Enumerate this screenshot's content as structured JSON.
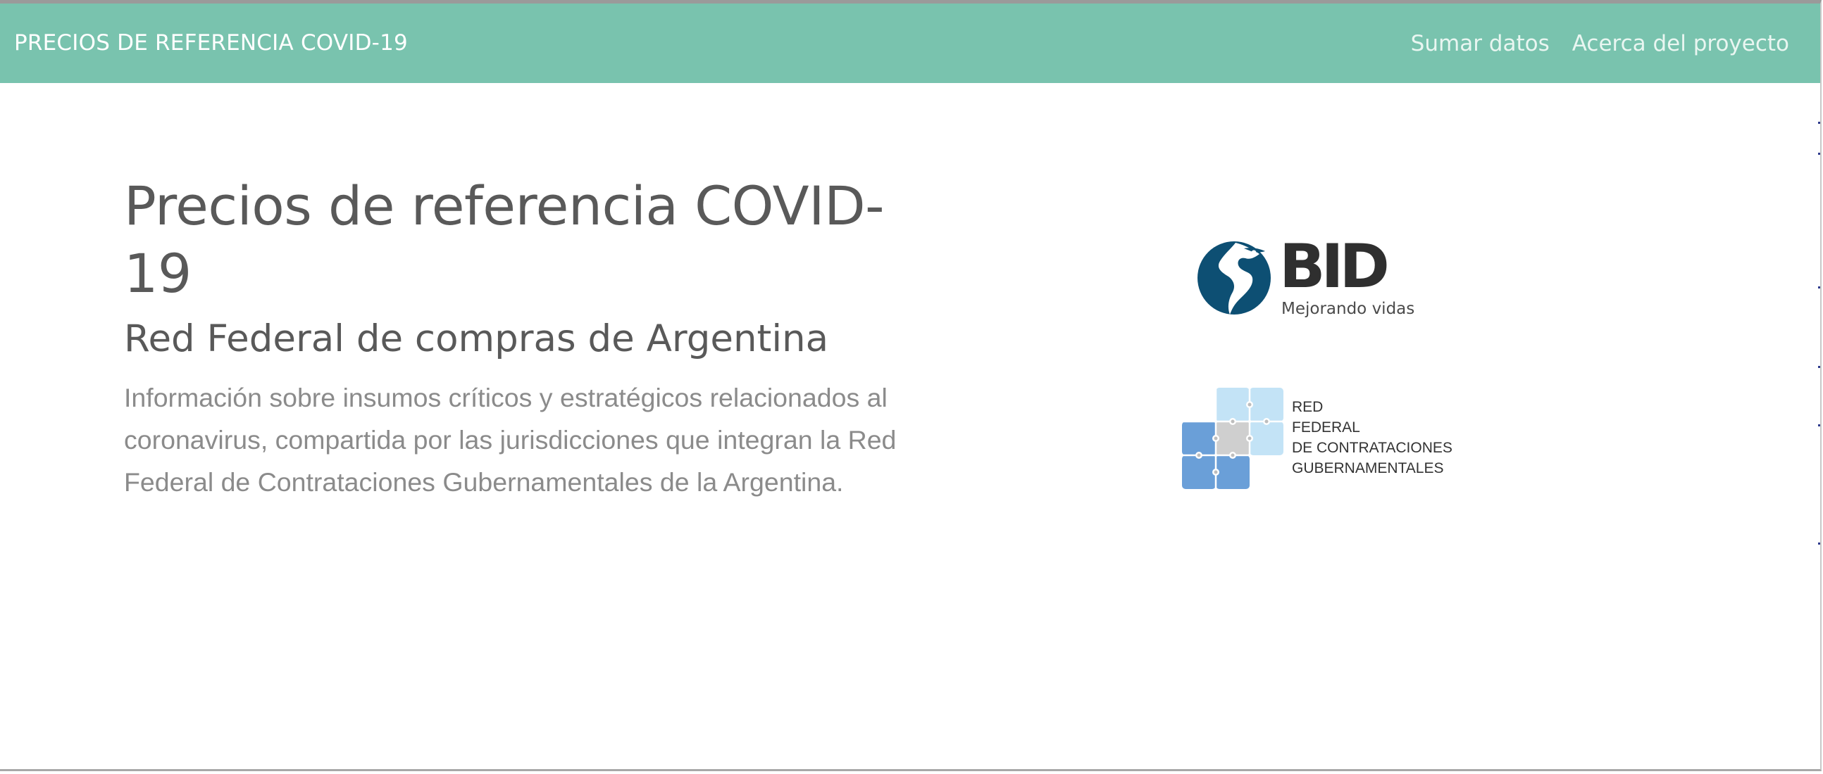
{
  "navbar": {
    "brand": "PRECIOS DE REFERENCIA COVID-19",
    "links": [
      "Sumar datos",
      "Acerca del proyecto"
    ],
    "background_color": "#79c3ae"
  },
  "hero": {
    "title": "Precios de referencia COVID-19",
    "subtitle": "Red Federal de compras de Argentina",
    "description": "Información sobre insumos críticos y estratégicos relacionados al coronavirus, compartida por las jurisdicciones que integran la Red Federal de Contrataciones Gubernamentales de la Argentina."
  },
  "logos": {
    "bid": {
      "name": "BID",
      "tagline": "Mejorando vidas",
      "icon": "americas-globe-icon",
      "color": "#0d4f73"
    },
    "red_federal": {
      "lines": [
        "RED",
        "FEDERAL",
        "DE CONTRATACIONES",
        "GUBERNAMENTALES"
      ],
      "icon": "puzzle-pieces-icon"
    }
  }
}
